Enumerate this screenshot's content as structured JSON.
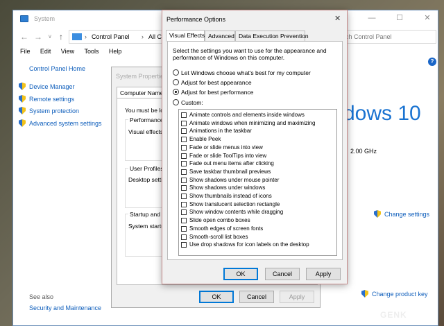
{
  "system_window": {
    "title": "System",
    "address_parts": [
      "Control Panel",
      "All Contro"
    ],
    "search_placeholder": "ch Control Panel",
    "menu": [
      "File",
      "Edit",
      "View",
      "Tools",
      "Help"
    ],
    "home_link": "Control Panel Home",
    "links": [
      "Device Manager",
      "Remote settings",
      "System protection",
      "Advanced system settings"
    ],
    "windows_brand": "dows 10",
    "cpu_speed": "2.00 GHz",
    "change_settings": "Change settings",
    "change_product_key": "Change product key",
    "see_also": "See also",
    "security_maintenance": "Security and Maintenance",
    "help_glyph": "?"
  },
  "system_properties": {
    "title": "System Propertie",
    "tab": "Computer Name",
    "admin_note": "You must be lo",
    "performance_title": "Performance",
    "performance_text": "Visual effects,",
    "profiles_title": "User Profiles",
    "profiles_text": "Desktop settir",
    "startup_title": "Startup and Re",
    "startup_text": "System startup",
    "buttons": {
      "ok": "OK",
      "cancel": "Cancel",
      "apply": "Apply"
    }
  },
  "performance_options": {
    "title": "Performance Options",
    "tabs": [
      "Visual Effects",
      "Advanced",
      "Data Execution Prevention"
    ],
    "description": "Select the settings you want to use for the appearance and performance of Windows on this computer.",
    "radios": [
      {
        "label": "Let Windows choose what's best for my computer",
        "selected": false
      },
      {
        "label": "Adjust for best appearance",
        "selected": false
      },
      {
        "label": "Adjust for best performance",
        "selected": true
      },
      {
        "label": "Custom:",
        "selected": false
      }
    ],
    "checkboxes": [
      "Animate controls and elements inside windows",
      "Animate windows when minimizing and maximizing",
      "Animations in the taskbar",
      "Enable Peek",
      "Fade or slide menus into view",
      "Fade or slide ToolTips into view",
      "Fade out menu items after clicking",
      "Save taskbar thumbnail previews",
      "Show shadows under mouse pointer",
      "Show shadows under windows",
      "Show thumbnails instead of icons",
      "Show translucent selection rectangle",
      "Show window contents while dragging",
      "Slide open combo boxes",
      "Smooth edges of screen fonts",
      "Smooth-scroll list boxes",
      "Use drop shadows for icon labels on the desktop"
    ],
    "buttons": {
      "ok": "OK",
      "cancel": "Cancel",
      "apply": "Apply"
    },
    "close_glyph": "✕"
  },
  "watermark": "GENK"
}
